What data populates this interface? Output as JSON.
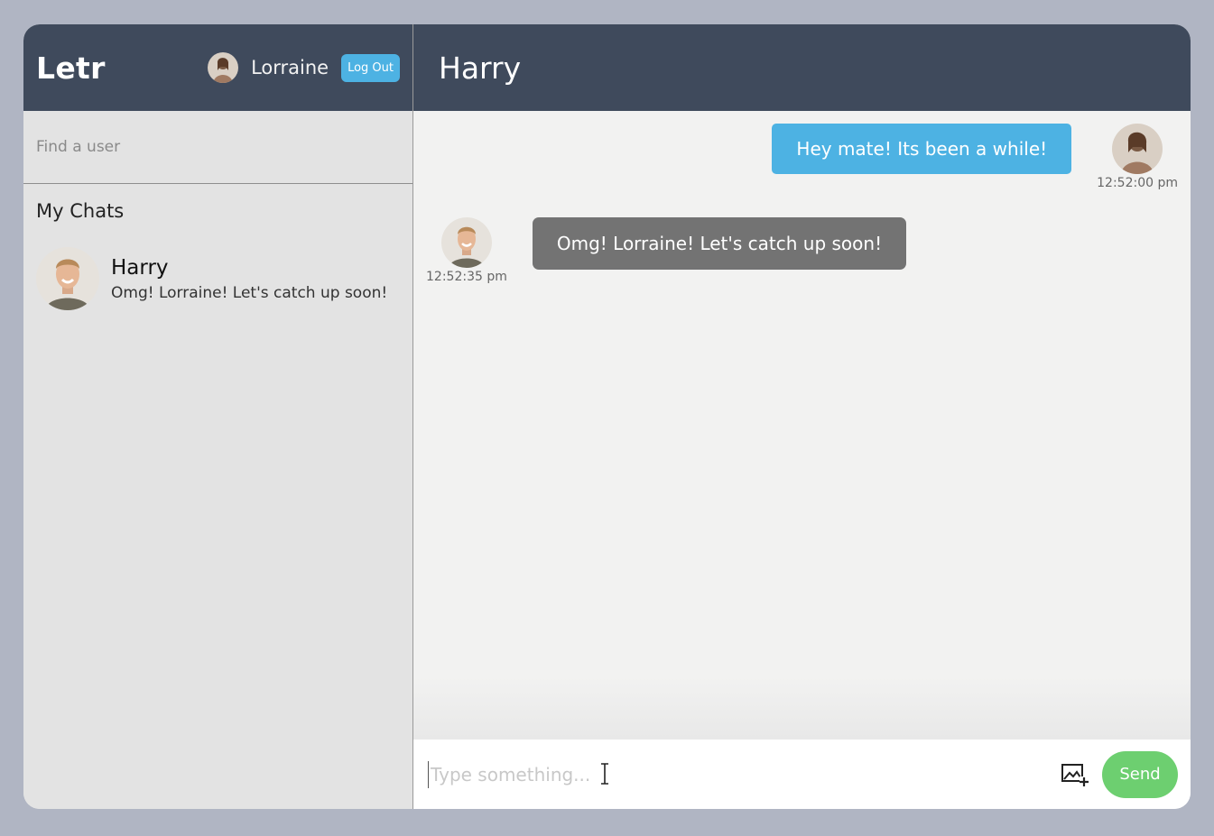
{
  "app": {
    "logo": "Letr"
  },
  "current_user": {
    "name": "Lorraine",
    "logout_label": "Log Out"
  },
  "search": {
    "placeholder": "Find a user"
  },
  "chats": {
    "title": "My Chats",
    "items": [
      {
        "name": "Harry",
        "preview": "Omg! Lorraine! Let's catch up soon!"
      }
    ]
  },
  "conversation": {
    "title": "Harry",
    "messages": [
      {
        "direction": "outgoing",
        "text": "Hey mate! Its been a while!",
        "time": "12:52:00 pm"
      },
      {
        "direction": "incoming",
        "text": "Omg! Lorraine! Let's catch up soon!",
        "time": "12:52:35 pm"
      }
    ]
  },
  "composer": {
    "placeholder": "Type something...",
    "send_label": "Send",
    "image_icon": "add-image-icon"
  },
  "colors": {
    "header_bg": "#3f4a5c",
    "accent_blue": "#4db2e3",
    "send_green": "#6dcf70",
    "incoming_bubble": "#737373",
    "page_bg": "#b0b5c3"
  }
}
